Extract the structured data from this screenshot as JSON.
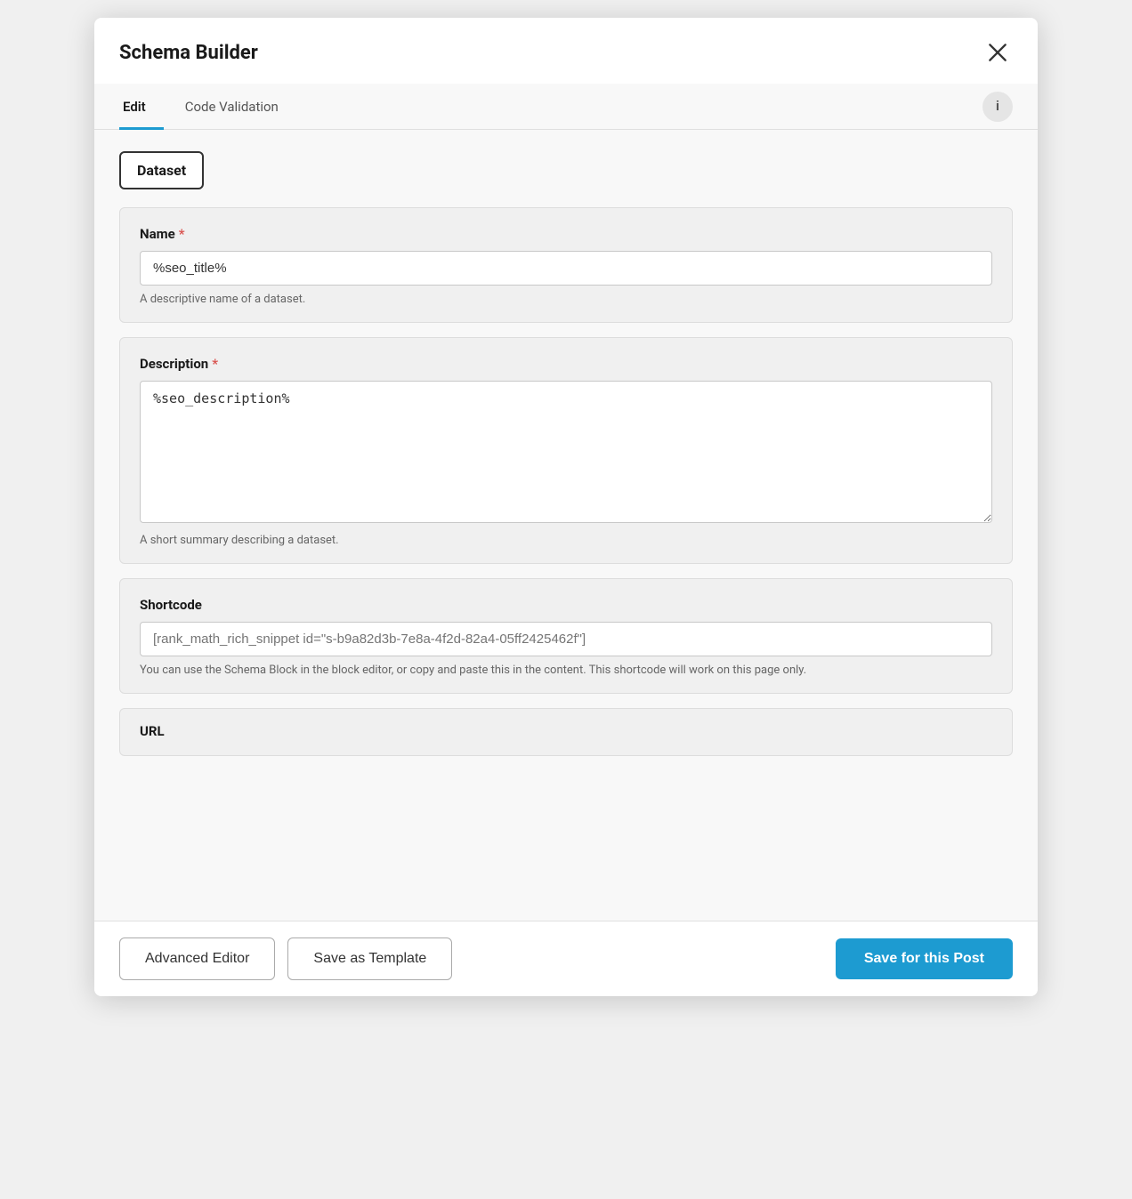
{
  "modal": {
    "title": "Schema Builder",
    "close_label": "Close"
  },
  "tabs": {
    "items": [
      {
        "label": "Edit",
        "active": true
      },
      {
        "label": "Code Validation",
        "active": false
      }
    ],
    "info_label": "i"
  },
  "dataset_selector": {
    "label": "Dataset"
  },
  "fields": {
    "name": {
      "label": "Name",
      "required": true,
      "value": "%seo_title%",
      "hint": "A descriptive name of a dataset."
    },
    "description": {
      "label": "Description",
      "required": true,
      "value": "%seo_description%",
      "hint": "A short summary describing a dataset."
    },
    "shortcode": {
      "label": "Shortcode",
      "required": false,
      "placeholder": "[rank_math_rich_snippet id=\"s-b9a82d3b-7e8a-4f2d-82a4-05ff2425462f\"]",
      "hint": "You can use the Schema Block in the block editor, or copy and paste this in the content. This shortcode will work on this page only."
    },
    "url": {
      "label": "URL",
      "required": false
    }
  },
  "footer": {
    "advanced_editor": "Advanced Editor",
    "save_template": "Save as Template",
    "save_post": "Save for this Post"
  }
}
